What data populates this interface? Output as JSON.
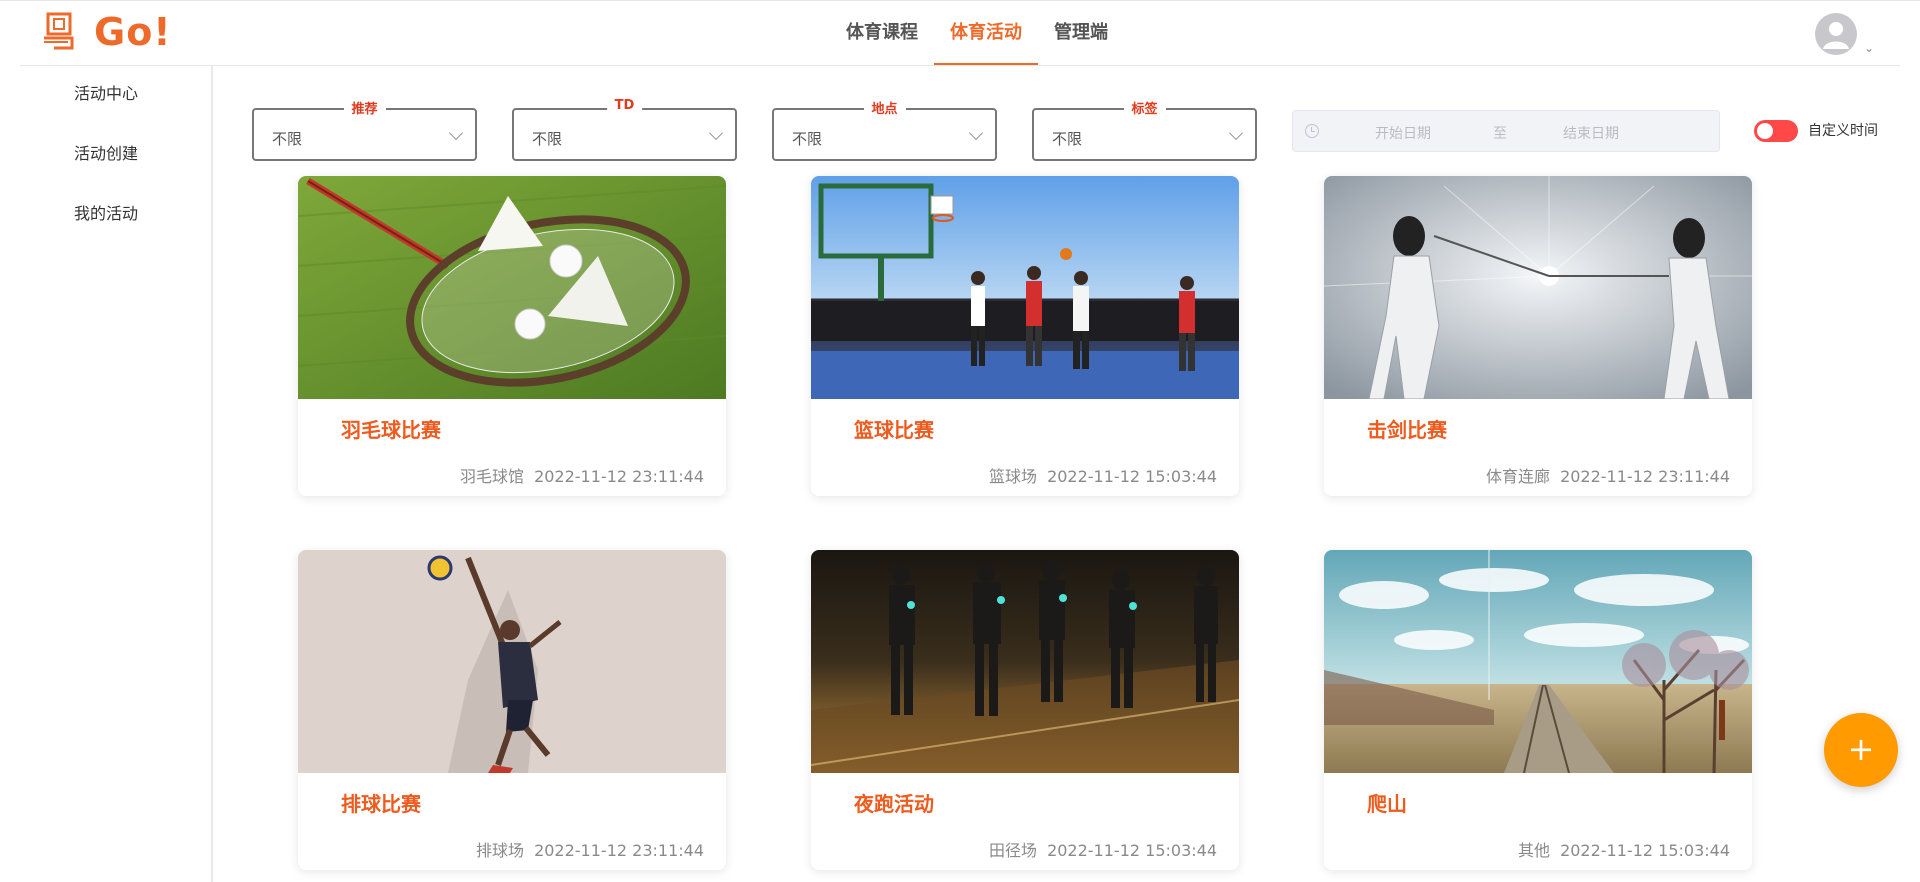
{
  "app": {
    "logo_text": "Go!",
    "accent": "#ee6a2b"
  },
  "nav": {
    "tabs": [
      {
        "label": "体育课程",
        "active": false
      },
      {
        "label": "体育活动",
        "active": true
      },
      {
        "label": "管理端",
        "active": false
      }
    ]
  },
  "user": {
    "avatar_icon": "user-avatar-icon"
  },
  "sidebar": {
    "items": [
      {
        "label": "活动中心"
      },
      {
        "label": "活动创建"
      },
      {
        "label": "我的活动"
      }
    ]
  },
  "filters": [
    {
      "label": "推荐",
      "value": "不限"
    },
    {
      "label": "TD",
      "value": "不限"
    },
    {
      "label": "地点",
      "value": "不限"
    },
    {
      "label": "标签",
      "value": "不限"
    }
  ],
  "date_range": {
    "start_placeholder": "开始日期",
    "separator": "至",
    "end_placeholder": "结束日期"
  },
  "custom_time": {
    "label": "自定义时间",
    "on": true,
    "color": "#ff4949"
  },
  "activities": [
    {
      "title": "羽毛球比赛",
      "location": "羽毛球馆",
      "time": "2022-11-12 23:11:44",
      "image": "badminton"
    },
    {
      "title": "篮球比赛",
      "location": "篮球场",
      "time": "2022-11-12 15:03:44",
      "image": "basketball"
    },
    {
      "title": "击剑比赛",
      "location": "体育连廊",
      "time": "2022-11-12 23:11:44",
      "image": "fencing"
    },
    {
      "title": "排球比赛",
      "location": "排球场",
      "time": "2022-11-12 23:11:44",
      "image": "volleyball"
    },
    {
      "title": "夜跑活动",
      "location": "田径场",
      "time": "2022-11-12 15:03:44",
      "image": "night-run"
    },
    {
      "title": "爬山",
      "location": "其他",
      "time": "2022-11-12 15:03:44",
      "image": "landscape"
    }
  ],
  "fab": {
    "label": "+"
  }
}
